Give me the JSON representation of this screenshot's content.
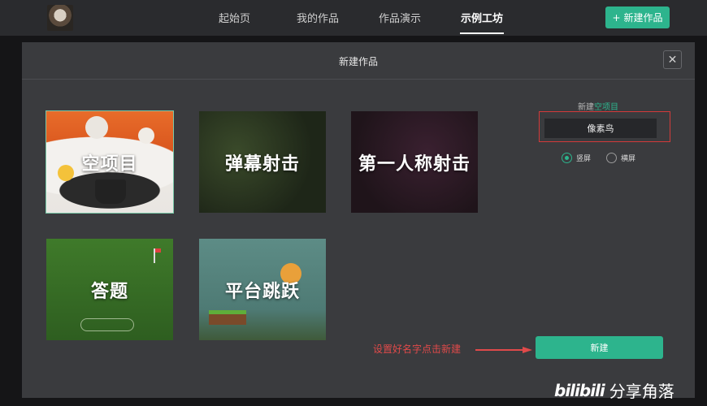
{
  "nav": {
    "items": [
      "起始页",
      "我的作品",
      "作品演示",
      "示例工坊"
    ],
    "active_index": 3,
    "new_work_button": "新建作品",
    "plus_icon": "plus-icon"
  },
  "modal": {
    "title": "新建作品",
    "close_icon": "close-icon",
    "templates": [
      "空项目",
      "弹幕射击",
      "第一人称射击",
      "答题",
      "平台跳跃"
    ],
    "selected_template": "空项目",
    "side_hint_prefix": "新建",
    "side_hint_accent": "空项目",
    "name_input_value": "像素鸟",
    "orientation_options": [
      "竖屏",
      "横屏"
    ],
    "orientation_selected": "竖屏",
    "create_button": "新建",
    "annotation": "设置好名字点击新建"
  },
  "watermark": {
    "logo": "bilibili",
    "text": "分享角落"
  },
  "colors": {
    "accent": "#2db48d",
    "annotation_red": "#e04a4a",
    "modal_bg": "#3a3b3e",
    "topbar_bg": "#2a2b2e"
  }
}
